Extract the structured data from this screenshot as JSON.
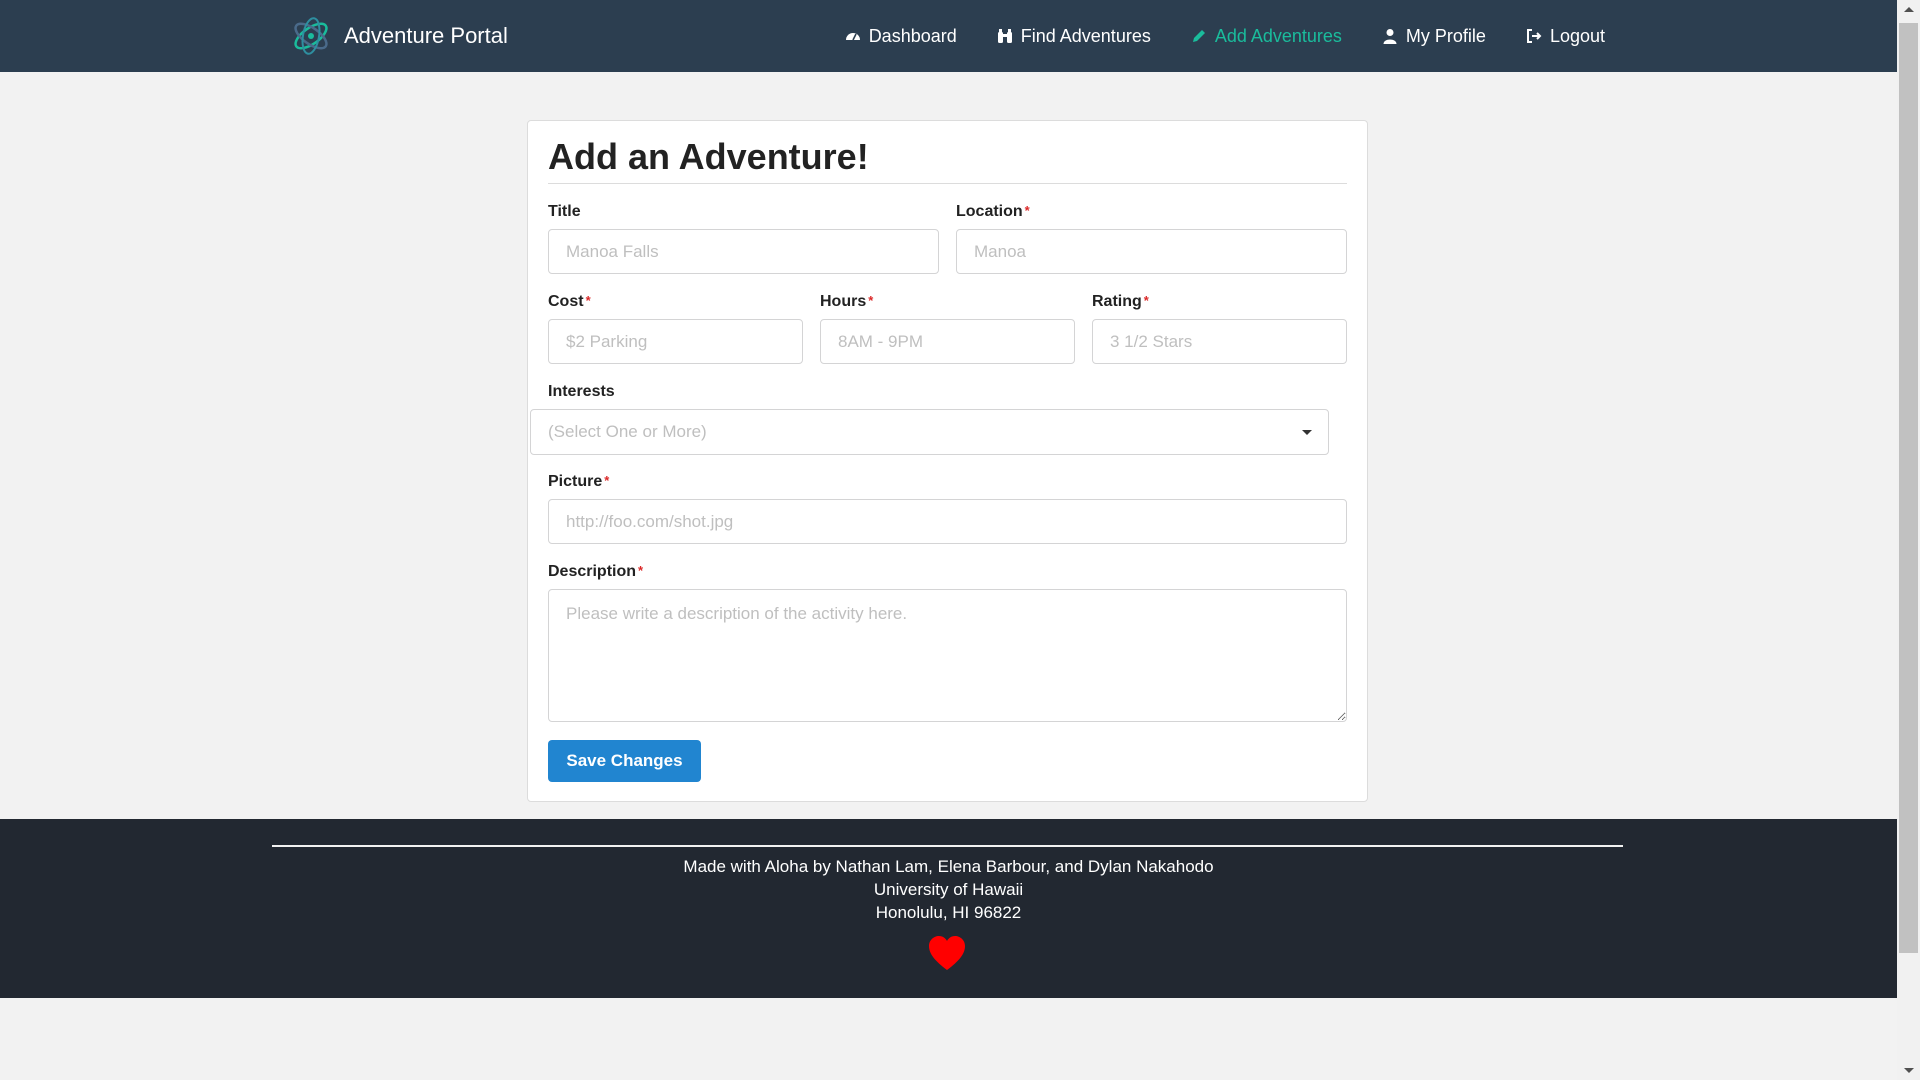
{
  "navbar": {
    "brand": "Adventure Portal",
    "items": [
      {
        "label": "Dashboard",
        "icon": "dashboard-icon"
      },
      {
        "label": "Find Adventures",
        "icon": "binoculars-icon"
      },
      {
        "label": "Add Adventures",
        "icon": "pencil-icon",
        "active": true
      },
      {
        "label": "My Profile",
        "icon": "user-icon"
      },
      {
        "label": "Logout",
        "icon": "sign-out-icon"
      }
    ],
    "accent_color": "#1abc9c",
    "background": "#2c3e50"
  },
  "form": {
    "heading": "Add an Adventure!",
    "title": {
      "label": "Title",
      "placeholder": "Manoa Falls",
      "value": ""
    },
    "location": {
      "label": "Location",
      "placeholder": "Manoa",
      "value": ""
    },
    "cost": {
      "label": "Cost",
      "placeholder": "$2 Parking",
      "value": ""
    },
    "hours": {
      "label": "Hours",
      "placeholder": "8AM - 9PM",
      "value": ""
    },
    "rating": {
      "label": "Rating",
      "placeholder": "3 1/2 Stars",
      "value": ""
    },
    "interests": {
      "label": "Interests",
      "placeholder": "(Select One or More)"
    },
    "picture": {
      "label": "Picture",
      "placeholder": "http://foo.com/shot.jpg",
      "value": ""
    },
    "description": {
      "label": "Description",
      "placeholder": "Please write a description of the activity here.",
      "value": ""
    },
    "required_marker": "*",
    "save_label": "Save Changes",
    "button_color": "#2185d0"
  },
  "footer": {
    "line1": "Made with Aloha by Nathan Lam, Elena Barbour, and Dylan Nakahodo",
    "line2": "University of Hawaii",
    "line3": "Honolulu, HI 96822",
    "icon": "heart-icon",
    "heart_color": "#ff0000"
  }
}
